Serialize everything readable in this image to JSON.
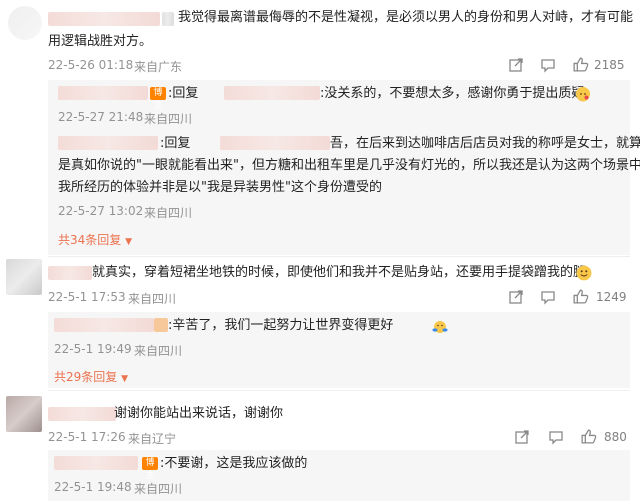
{
  "comments": [
    {
      "text_line1": "我觉得最离谱最侮辱的不是性凝视，是必须以男人的身份和男人对峙，才有可能",
      "text_line2": "用逻辑战胜对方。",
      "time": "22-5-26 01:18",
      "location": "来自广东",
      "likes": "2185",
      "replies": [
        {
          "badge": "博主",
          "prefix": ":回复",
          "text": ":没关系的，不要想太多，感谢你勇于提出质疑",
          "emoji": "kissing-face",
          "time": "22-5-27 21:48",
          "location": "来自四川"
        },
        {
          "prefix": ":回复",
          "text_line1": "吾，在后来到达咖啡店后店员对我的称呼是女士，就算",
          "text_line2": "是真如你说的\"一眼就能看出来\"，但方糖和出租车里是几乎没有灯光的，所以我还是认为这两个场景中",
          "text_line3": "我所经历的体验并非是以\"我是异装男性\"这个身份遭受的",
          "time": "22-5-27 13:02",
          "location": "来自四川"
        }
      ],
      "more_replies": "共34条回复"
    },
    {
      "text": "就真实，穿着短裙坐地铁的时候，即使他们和我并不是贴身站，还要用手提袋蹭我的腿",
      "emoji": "slightly-smiling-face",
      "time": "22-5-1 17:53",
      "location": "来自四川",
      "likes": "1249",
      "replies": [
        {
          "text": ":辛苦了，我们一起努力让世界变得更好",
          "emoji": "hugging-face",
          "time": "22-5-1 19:49",
          "location": "来自四川"
        }
      ],
      "more_replies": "共29条回复"
    },
    {
      "text": "谢谢你能站出来说话，谢谢你",
      "time": "22-5-1 17:26",
      "location": "来自辽宁",
      "likes": "880",
      "replies": [
        {
          "badge": "博主",
          "text": ":不要谢，这是我应该做的",
          "time": "22-5-1 19:48",
          "location": "来自四川"
        }
      ]
    }
  ],
  "colors": {
    "accent": "#eb7350",
    "badge": "#ff8200",
    "meta": "#939393"
  },
  "icons": {
    "share": "share-icon",
    "comment": "comment-icon",
    "like": "thumbs-up-icon",
    "more": "chevron-down-icon"
  }
}
